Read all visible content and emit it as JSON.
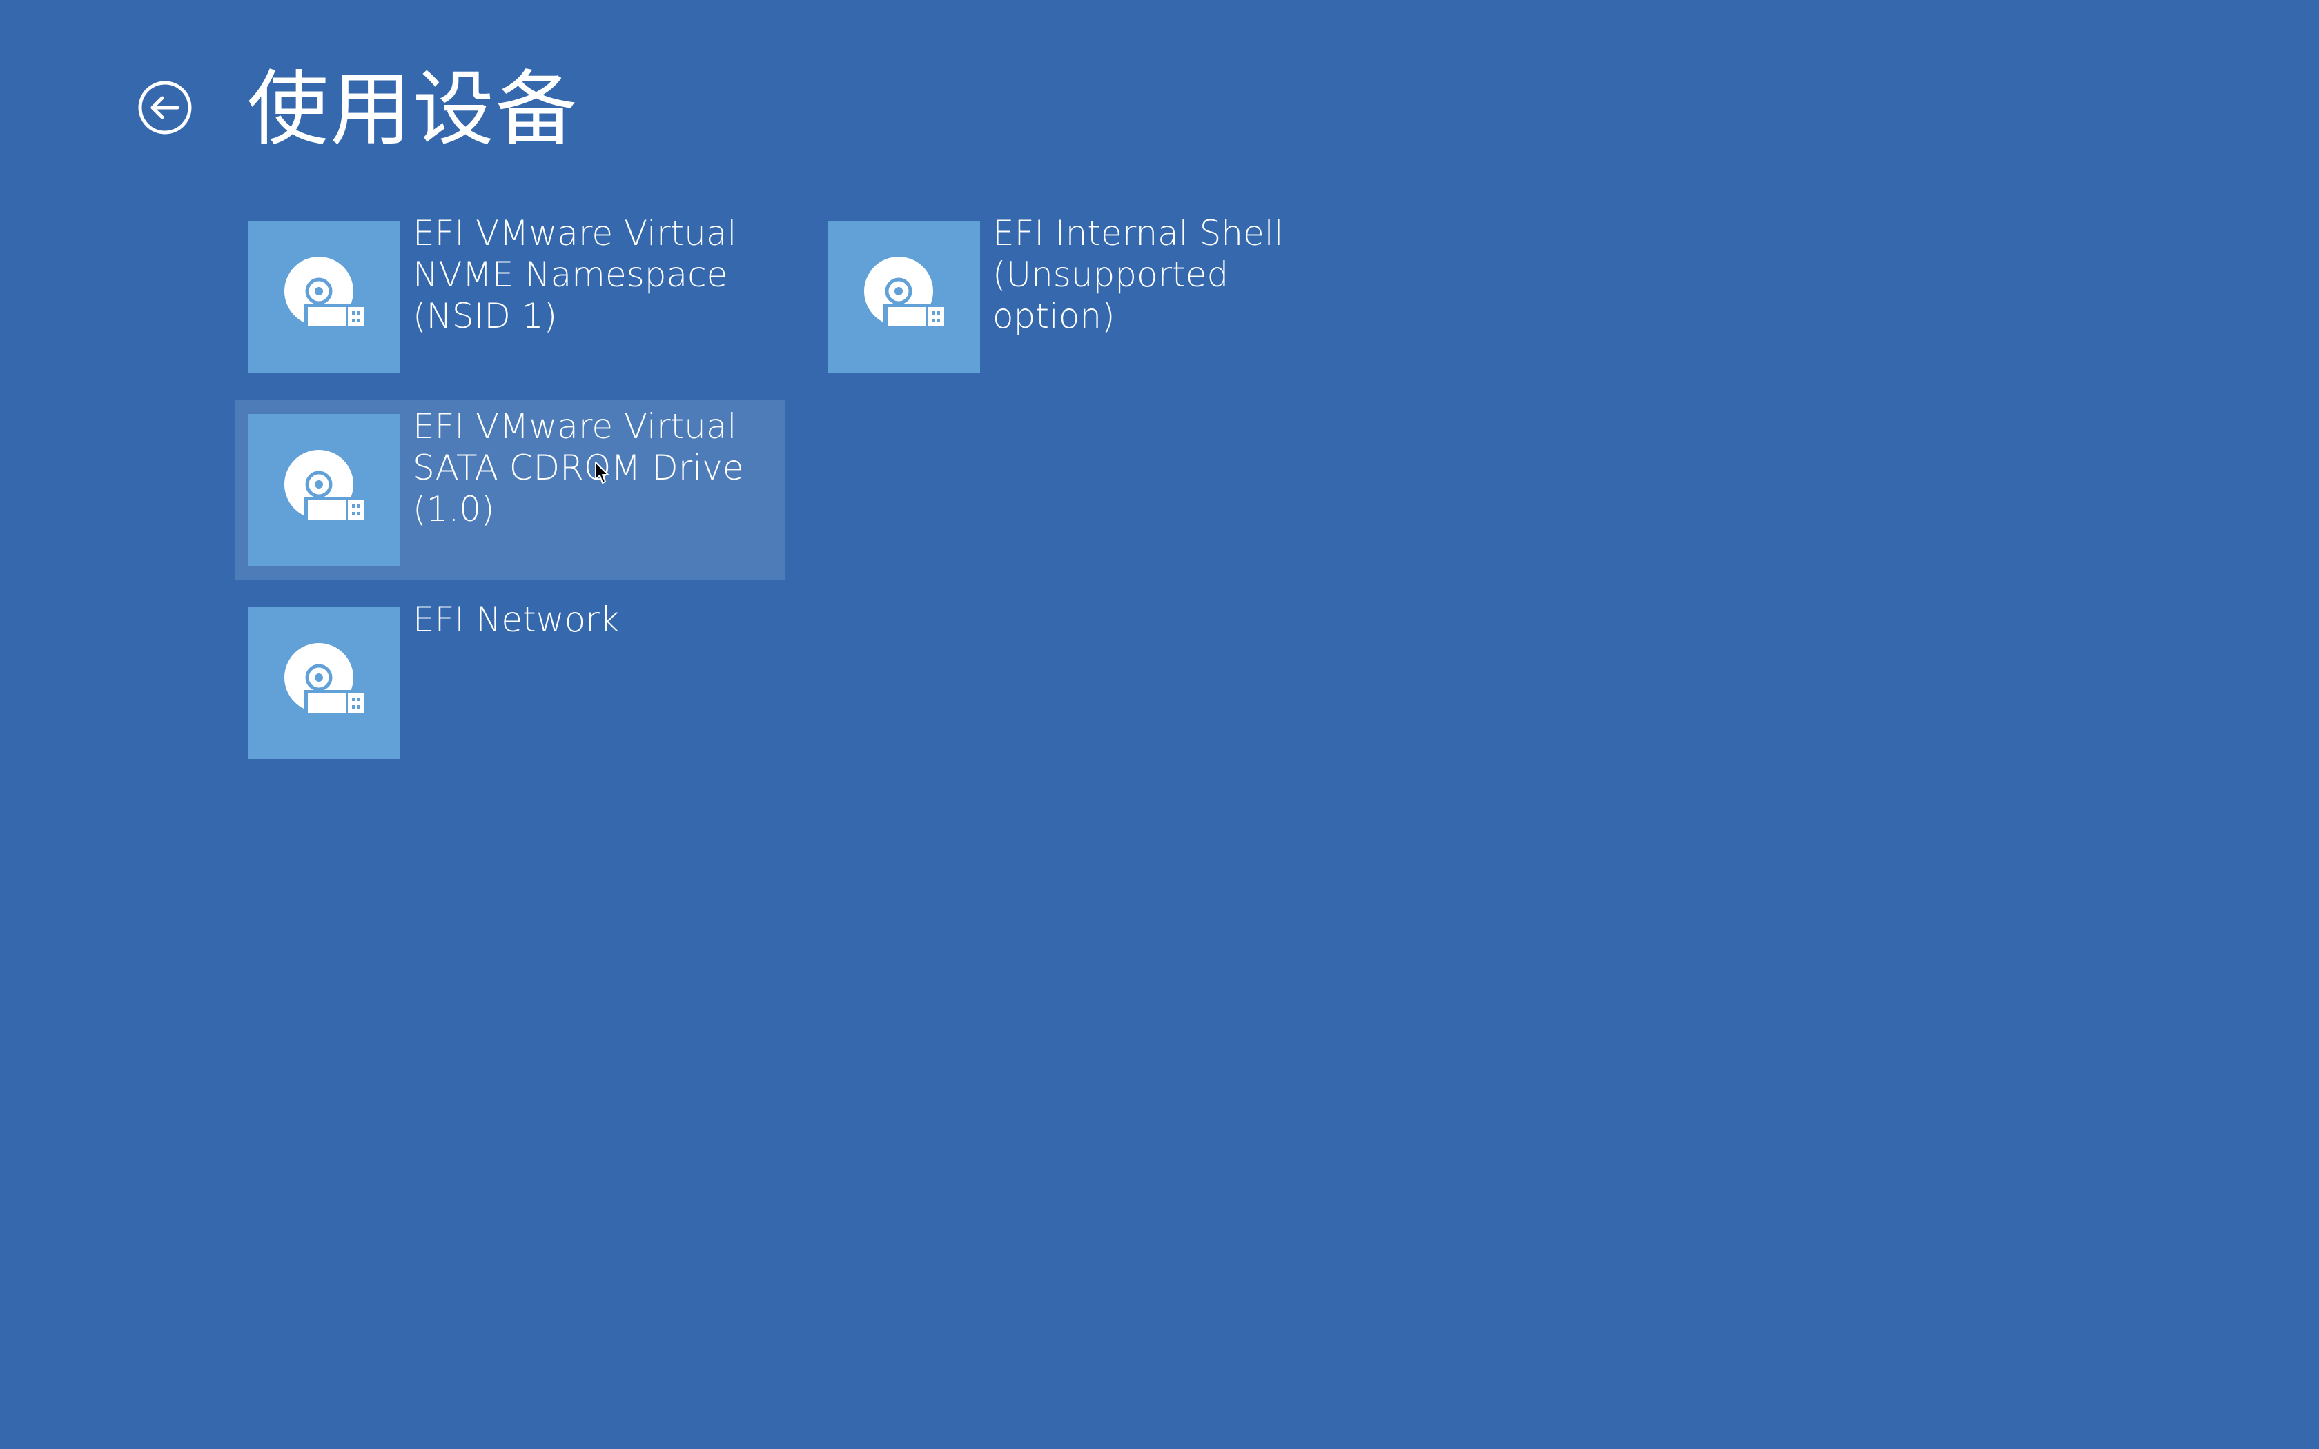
{
  "header": {
    "title": "使用设备",
    "back_icon": "back-arrow-circle-icon"
  },
  "devices": [
    {
      "label": "EFI VMware Virtual\nNVME Namespace\n(NSID 1)",
      "icon": "usb-drive-disc-icon",
      "hovered": false
    },
    {
      "label": "EFI Internal Shell\n(Unsupported\noption)",
      "icon": "usb-drive-disc-icon",
      "hovered": false
    },
    {
      "label": "EFI VMware Virtual\nSATA CDROM Drive\n(1.0)",
      "icon": "usb-drive-disc-icon",
      "hovered": true
    },
    {
      "label": "EFI Network",
      "icon": "usb-drive-disc-icon",
      "hovered": false
    }
  ],
  "colors": {
    "background": "#3668ae",
    "tile_icon_bg": "#62a1d8",
    "tile_hover_bg": "#4d7cb9",
    "text": "#ffffff"
  }
}
